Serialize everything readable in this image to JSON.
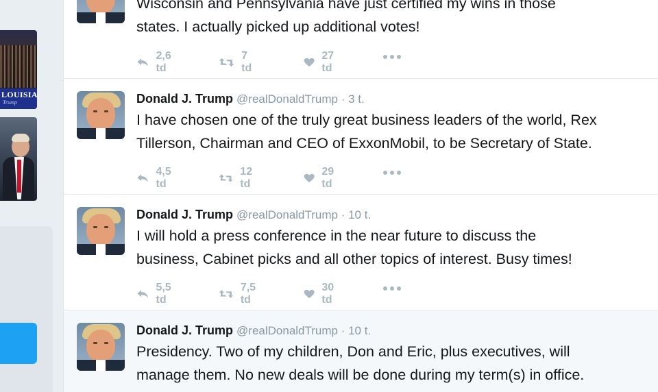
{
  "sidebar": {
    "rally_banner_text": "LOUISIA",
    "rally_banner_sub": "Trump"
  },
  "tweets": [
    {
      "name": "",
      "handle": "",
      "text_lines": [
        "Wisconsin and Pennsylvania have just certified my wins in those",
        "states. I actually picked up additional votes!"
      ],
      "replies": "2,6 td",
      "retweets": "7 td",
      "likes": "27 td"
    },
    {
      "name": "Donald J. Trump",
      "handle": "@realDonaldTrump · 3 t.",
      "text_lines": [
        "I have chosen one of the truly great business leaders of the world, Rex",
        "Tillerson, Chairman and CEO of ExxonMobil, to be Secretary of State."
      ],
      "replies": "4,5 td",
      "retweets": "12 td",
      "likes": "29 td"
    },
    {
      "name": "Donald J. Trump",
      "handle": "@realDonaldTrump · 10 t.",
      "text_lines": [
        "I will hold a press conference in the near future to discuss the",
        "business, Cabinet picks and all other topics of interest. Busy times!"
      ],
      "replies": "5,5 td",
      "retweets": "7,5 td",
      "likes": "30 td"
    },
    {
      "name": "Donald J. Trump",
      "handle": "@realDonaldTrump · 10 t.",
      "text_lines": [
        "Presidency. Two of my children, Don and Eric, plus executives, will",
        "manage them. No new deals will be done during my term(s) in office."
      ],
      "replies": "",
      "retweets": "",
      "likes": ""
    }
  ],
  "colors": {
    "accent": "#1da1f2",
    "muted": "#8899a6",
    "action_count": "#aab8c2"
  },
  "icons": [
    "reply-icon",
    "retweet-icon",
    "like-icon",
    "more-icon"
  ]
}
